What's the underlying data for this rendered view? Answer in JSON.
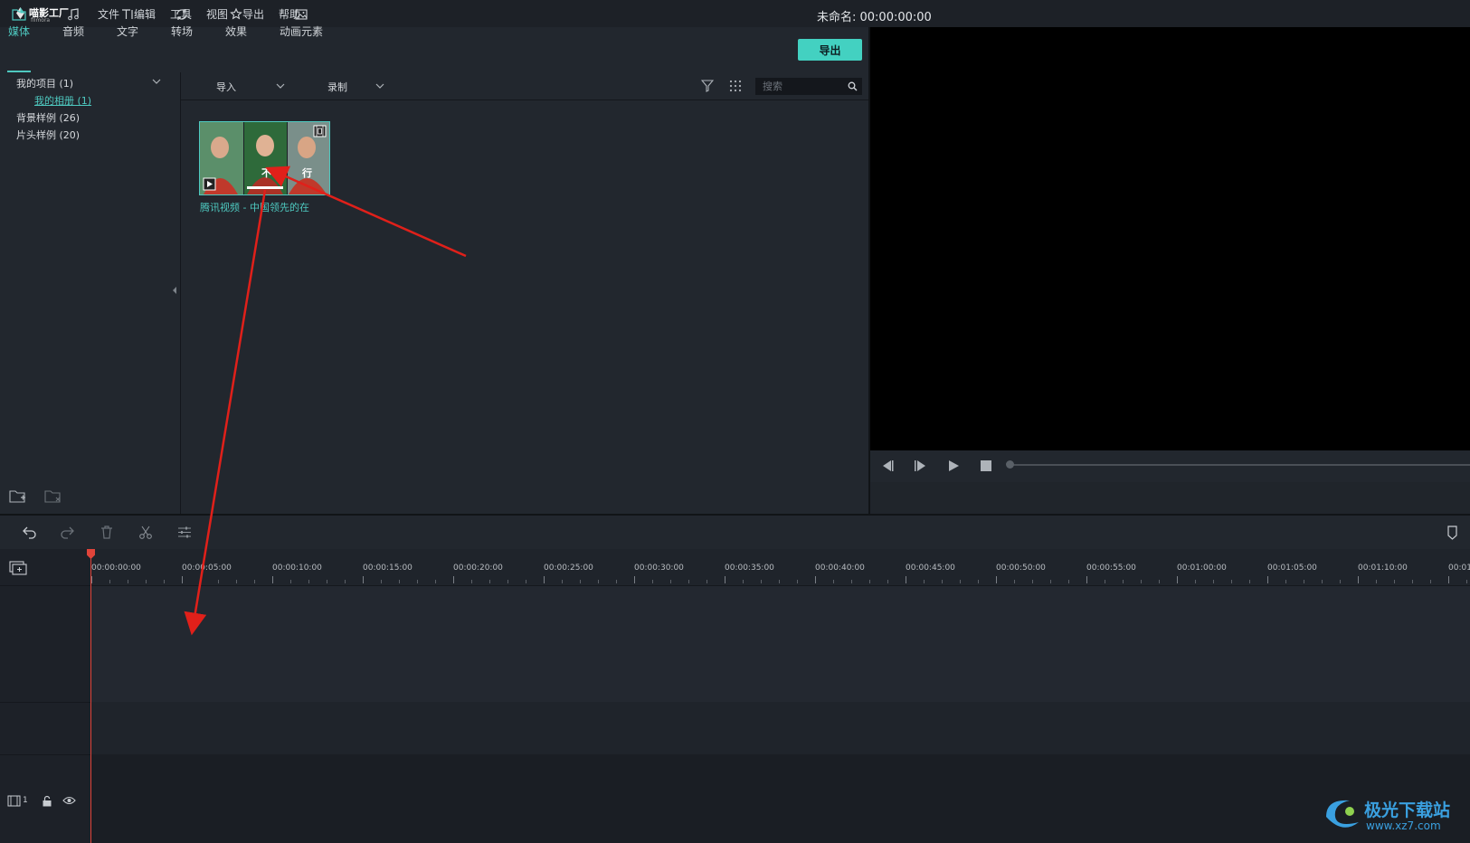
{
  "app": {
    "logo_name": "喵影工厂",
    "logo_sub": "filmora"
  },
  "menu": [
    "文件",
    "编辑",
    "工具",
    "视图",
    "导出",
    "帮助"
  ],
  "project": {
    "title": "未命名: 00:00:00:00"
  },
  "tabs": [
    {
      "label": "媒体",
      "icon": "folder-icon"
    },
    {
      "label": "音频",
      "icon": "music-note-icon"
    },
    {
      "label": "文字",
      "icon": "text-icon"
    },
    {
      "label": "转场",
      "icon": "transition-icon"
    },
    {
      "label": "效果",
      "icon": "effects-icon"
    },
    {
      "label": "动画元素",
      "icon": "image-icon"
    }
  ],
  "export_label": "导出",
  "sidebar": {
    "items": [
      {
        "label": "我的项目 (1)"
      },
      {
        "label": "我的相册 (1)"
      },
      {
        "label": "背景样例 (26)"
      },
      {
        "label": "片头样例 (20)"
      }
    ]
  },
  "media_toolbar": {
    "import_label": "导入",
    "record_label": "录制",
    "search_placeholder": "搜索"
  },
  "media_items": [
    {
      "caption": "腾讯视频 - 中国领先的在",
      "thumb_chars": [
        "不",
        "行"
      ]
    }
  ],
  "timeline": {
    "ticks": [
      "00:00:00:00",
      "00:00:05:00",
      "00:00:10:00",
      "00:00:15:00",
      "00:00:20:00",
      "00:00:25:00",
      "00:00:30:00",
      "00:00:35:00",
      "00:00:40:00",
      "00:00:45:00",
      "00:00:50:00",
      "00:00:55:00",
      "00:01:00:00",
      "00:01:05:00",
      "00:01:10:00",
      "00:01"
    ],
    "track_label": "1"
  },
  "watermark": {
    "text": "极光下载站",
    "url": "www.xz7.com"
  },
  "colors": {
    "accent": "#4ec9c0",
    "arrow": "#e0201a",
    "playhead": "#e0443a"
  }
}
